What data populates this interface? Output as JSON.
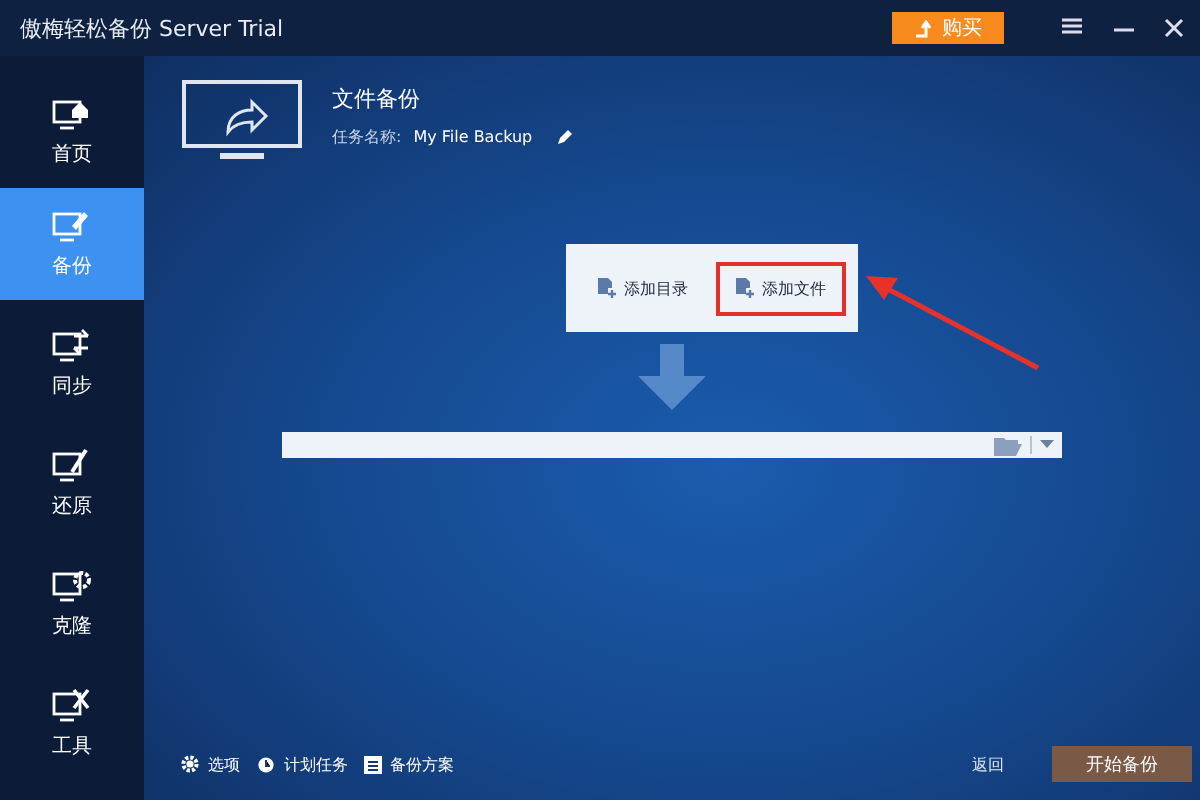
{
  "window": {
    "title": "傲梅轻松备份 Server Trial",
    "buy_button": "购买"
  },
  "sidebar": {
    "items": [
      {
        "label": "首页",
        "kind": "home",
        "selected": false
      },
      {
        "label": "备份",
        "kind": "backup",
        "selected": true
      },
      {
        "label": "同步",
        "kind": "sync",
        "selected": false
      },
      {
        "label": "还原",
        "kind": "restore",
        "selected": false
      },
      {
        "label": "克隆",
        "kind": "clone",
        "selected": false
      },
      {
        "label": "工具",
        "kind": "tools",
        "selected": false
      }
    ]
  },
  "header": {
    "title": "文件备份",
    "task_label": "任务名称:",
    "task_name": "My File Backup"
  },
  "add_menu": {
    "items": [
      {
        "label": "添加目录",
        "highlighted": false
      },
      {
        "label": "添加文件",
        "highlighted": true
      }
    ]
  },
  "footer": {
    "links": [
      {
        "label": "选项",
        "kind": "gear"
      },
      {
        "label": "计划任务",
        "kind": "alarm"
      },
      {
        "label": "备份方案",
        "kind": "clipboard"
      }
    ],
    "back_button": "返回",
    "start_button": "开始备份"
  }
}
